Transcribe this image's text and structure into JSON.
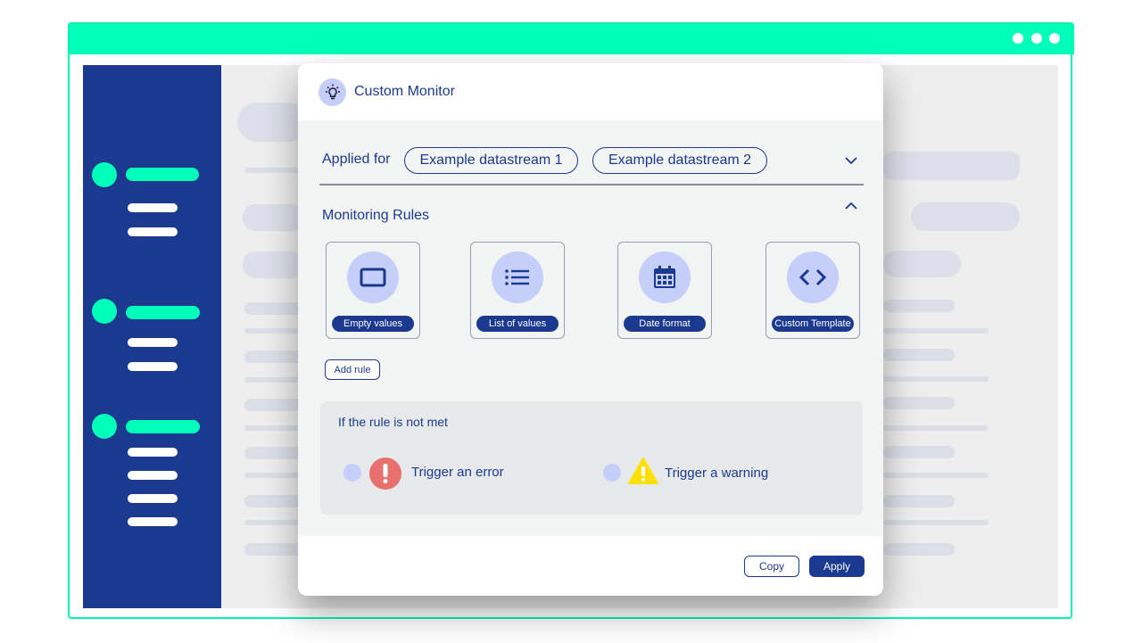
{
  "modal": {
    "title": "Custom Monitor",
    "applied_for_label": "Applied for",
    "datastreams": [
      "Example datastream 1",
      "Example datastream 2"
    ],
    "monitoring_rules_title": "Monitoring Rules",
    "rules": [
      {
        "label": "Empty values",
        "icon": "rectangle-icon"
      },
      {
        "label": "List of values",
        "icon": "list-icon"
      },
      {
        "label": "Date format",
        "icon": "calendar-icon"
      },
      {
        "label": "Custom Template",
        "icon": "code-icon"
      }
    ],
    "add_rule_label": "Add rule",
    "rule_not_met": {
      "title": "If the rule is not met",
      "options": [
        {
          "label": "Trigger an error",
          "icon": "error-icon"
        },
        {
          "label": "Trigger a warning",
          "icon": "warning-icon"
        }
      ]
    },
    "copy_label": "Copy",
    "apply_label": "Apply"
  },
  "colors": {
    "accent_green": "#00ffb8",
    "navy": "#1b3a8f",
    "radio_lilac": "#c5cffa",
    "error_red": "#e8706f",
    "warning_yellow": "#ffe000"
  }
}
